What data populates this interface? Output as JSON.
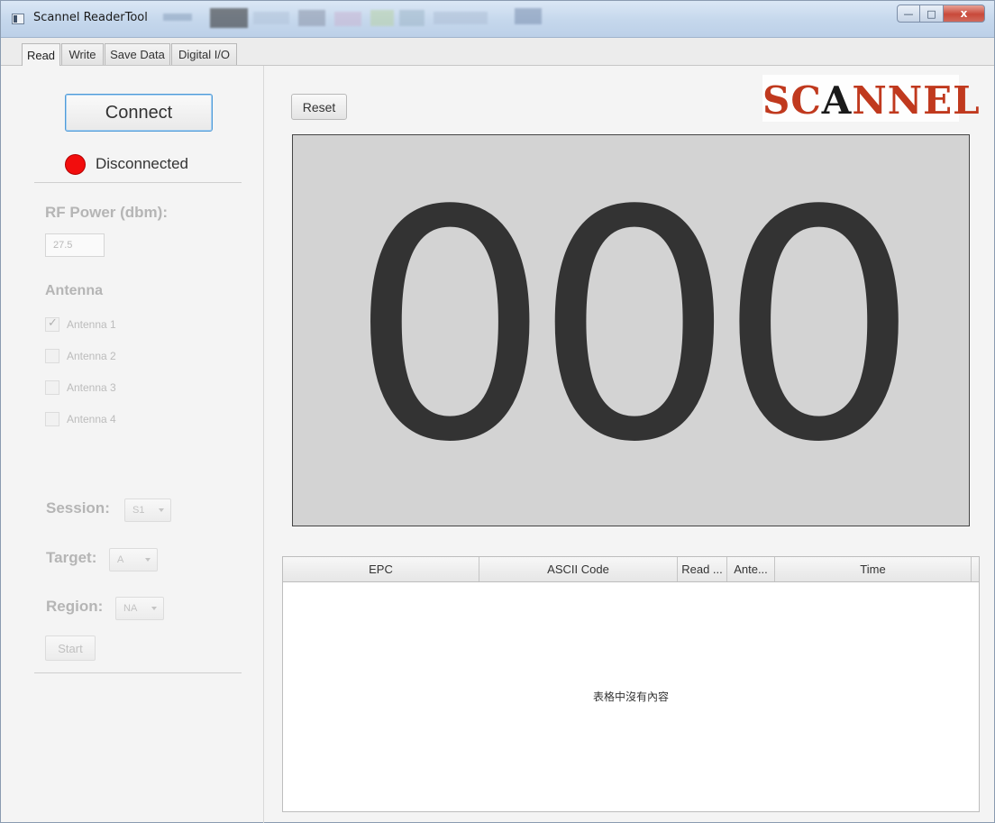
{
  "window": {
    "title": "Scannel ReaderTool",
    "icon": "app-window-icon",
    "controls": {
      "minimize": "—",
      "maximize": "□",
      "close": "x"
    }
  },
  "tabs": [
    {
      "label": "Read",
      "active": true
    },
    {
      "label": "Write",
      "active": false
    },
    {
      "label": "Save Data",
      "active": false
    },
    {
      "label": "Digital I/O",
      "active": false
    }
  ],
  "left": {
    "connect_label": "Connect",
    "status_text": "Disconnected",
    "status_color": "#f20d0d",
    "rf_power_label": "RF Power (dbm):",
    "rf_power_value": "27.5",
    "antenna_label": "Antenna",
    "antennas": [
      {
        "label": "Antenna 1",
        "checked": true
      },
      {
        "label": "Antenna 2",
        "checked": false
      },
      {
        "label": "Antenna 3",
        "checked": false
      },
      {
        "label": "Antenna 4",
        "checked": false
      }
    ],
    "session_label": "Session:",
    "session_value": "S1",
    "target_label": "Target:",
    "target_value": "A",
    "region_label": "Region:",
    "region_value": "NA",
    "start_label": "Start"
  },
  "main": {
    "reset_label": "Reset",
    "logo": {
      "part1": "SC",
      "part2": "A",
      "part3": "NNEL"
    },
    "counter": "000",
    "table": {
      "columns": [
        "EPC",
        "ASCII Code",
        "Read ...",
        "Ante...",
        "Time"
      ],
      "empty_message": "表格中沒有內容"
    }
  },
  "colors": {
    "logo_red": "#c0391e",
    "counter_bg": "#d3d3d3",
    "focus_blue": "#4f9bd8"
  }
}
